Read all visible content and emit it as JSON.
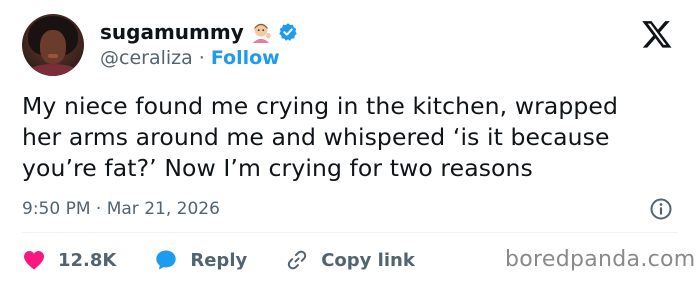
{
  "author": {
    "display_name": "sugamummy",
    "handle": "@ceraliza",
    "separator": "·",
    "follow_label": "Follow"
  },
  "tweet": {
    "lines": [
      "My niece found me crying in the kitchen, wrapped",
      "her arms around me and whispered ‘is it because",
      "you’re fat?’ Now I’m crying for two reasons"
    ],
    "timestamp": "9:50 PM · Mar 21, 2026"
  },
  "actions": {
    "like_count": "12.8K",
    "reply_label": "Reply",
    "copy_link_label": "Copy link"
  },
  "watermark": "boredpanda.com",
  "icons": {
    "emoji": "woman-tipping-hand-emoji-icon",
    "verified": "verified-badge-icon",
    "logo": "x-logo-icon",
    "info": "info-icon",
    "like": "heart-icon",
    "reply": "speech-bubble-icon",
    "copy": "link-icon"
  },
  "colors": {
    "text": "#0f1419",
    "secondary": "#536471",
    "accent": "#1d9bf0",
    "like": "#f91880"
  }
}
